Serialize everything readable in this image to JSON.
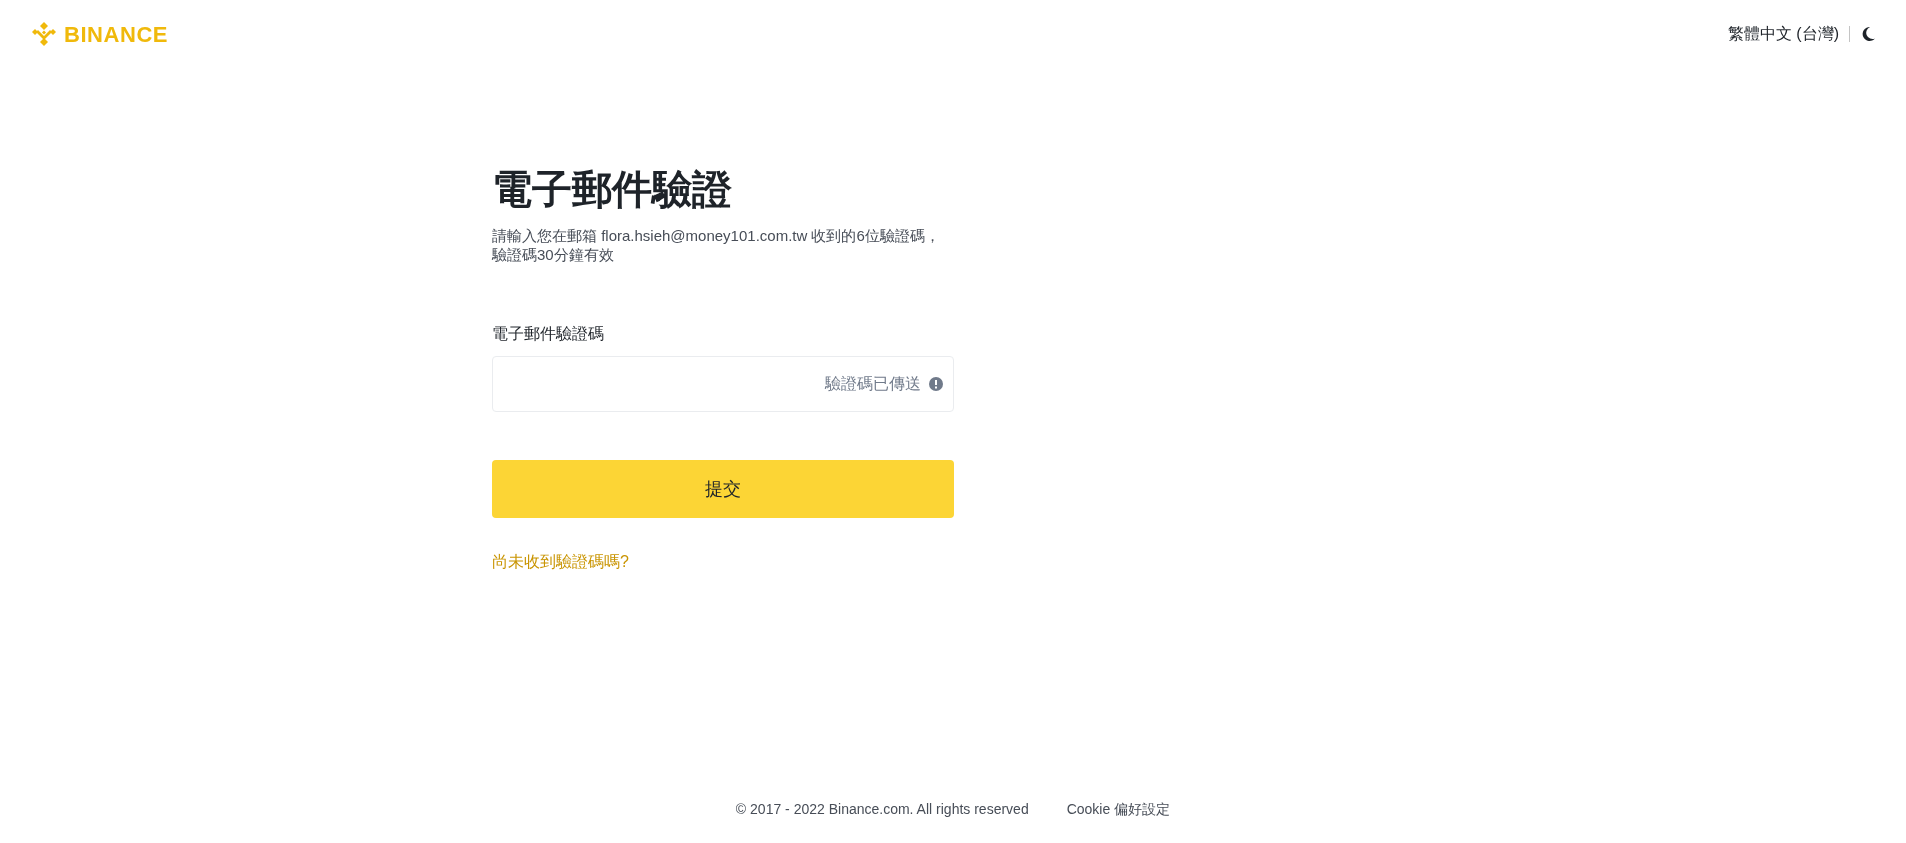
{
  "header": {
    "logo": "BINANCE",
    "language": "繁體中文 (台灣)"
  },
  "form": {
    "title": "電子郵件驗證",
    "description": "請輸入您在郵箱 flora.hsieh@money101.com.tw 收到的6位驗證碼，驗證碼30分鐘有效",
    "field_label": "電子郵件驗證碼",
    "field_status": "驗證碼已傳送",
    "submit": "提交",
    "help_link": "尚未收到驗證碼嗎?"
  },
  "footer": {
    "copyright": "© 2017 - 2022 Binance.com. All rights reserved",
    "cookie_link": "Cookie 偏好設定"
  }
}
